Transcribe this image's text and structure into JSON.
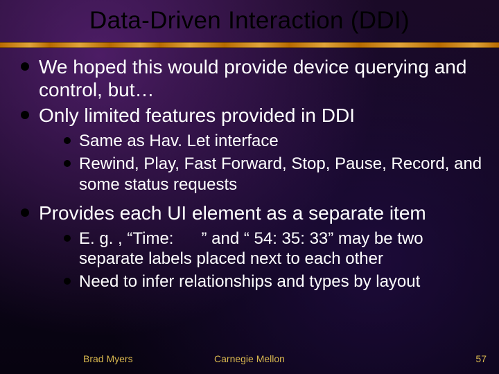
{
  "title": "Data-Driven Interaction (DDI)",
  "bullets": {
    "b1": "We hoped this would provide device querying and control, but…",
    "b2": "Only limited features provided in DDI",
    "b2_sub": {
      "s1": "Same as Hav. Let interface",
      "s2": "Rewind, Play, Fast Forward, Stop, Pause, Record, and some status requests"
    },
    "b3": "Provides each UI element as a separate item",
    "b3_sub": {
      "s1": "E. g. , “Time:      ” and “ 54: 35: 33” may be two separate labels placed next to each other",
      "s2": "Need to infer relationships and types by layout"
    }
  },
  "footer": {
    "author": "Brad Myers",
    "org": "Carnegie Mellon",
    "page": "57"
  }
}
